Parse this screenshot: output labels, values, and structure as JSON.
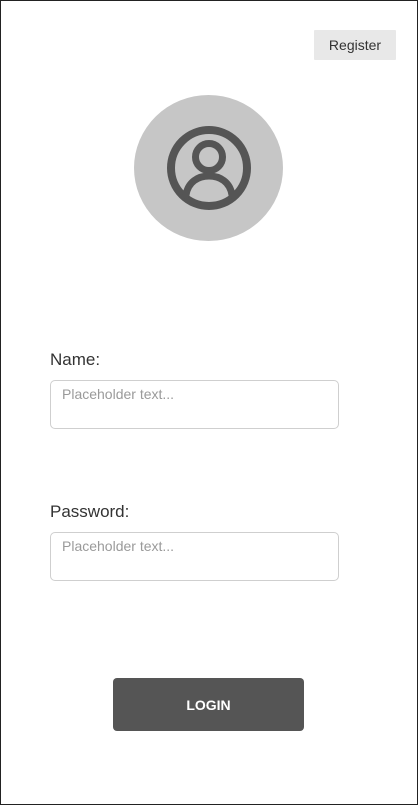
{
  "header": {
    "register_label": "Register"
  },
  "avatar": {
    "icon": "user-circle-icon",
    "background_color": "#c6c6c6",
    "icon_color": "#555555"
  },
  "form": {
    "name": {
      "label": "Name:",
      "value": "",
      "placeholder": "Placeholder text..."
    },
    "password": {
      "label": "Password:",
      "value": "",
      "placeholder": "Placeholder text..."
    }
  },
  "actions": {
    "login_label": "LOGIN",
    "login_color": "#555555"
  }
}
